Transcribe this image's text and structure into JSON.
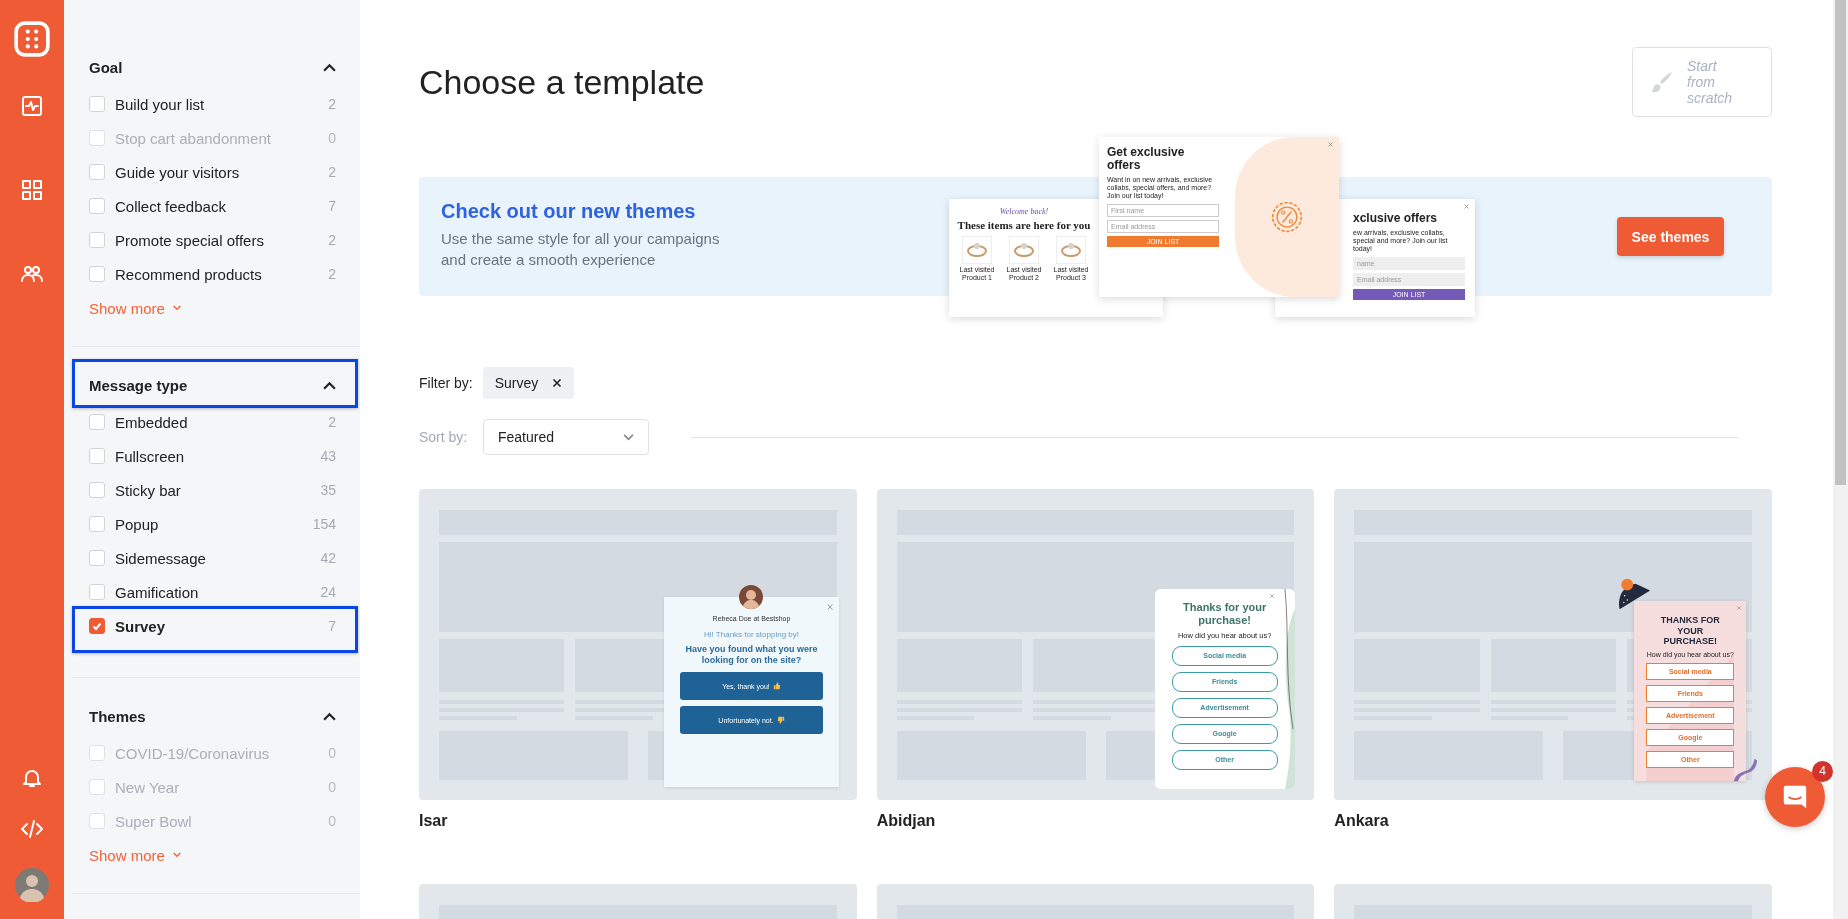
{
  "filters": [
    {
      "title": "Goal",
      "expanded": true,
      "highlighted": false,
      "show_more": "Show more",
      "items": [
        {
          "label": "Build your list",
          "count": "2",
          "checked": false,
          "disabled": false,
          "highlighted": false
        },
        {
          "label": "Stop cart abandonment",
          "count": "0",
          "checked": false,
          "disabled": true,
          "highlighted": false
        },
        {
          "label": "Guide your visitors",
          "count": "2",
          "checked": false,
          "disabled": false,
          "highlighted": false
        },
        {
          "label": "Collect feedback",
          "count": "7",
          "checked": false,
          "disabled": false,
          "highlighted": false
        },
        {
          "label": "Promote special offers",
          "count": "2",
          "checked": false,
          "disabled": false,
          "highlighted": false
        },
        {
          "label": "Recommend products",
          "count": "2",
          "checked": false,
          "disabled": false,
          "highlighted": false
        }
      ]
    },
    {
      "title": "Message type",
      "expanded": true,
      "highlighted": true,
      "items": [
        {
          "label": "Embedded",
          "count": "2",
          "checked": false,
          "disabled": false,
          "highlighted": false
        },
        {
          "label": "Fullscreen",
          "count": "43",
          "checked": false,
          "disabled": false,
          "highlighted": false
        },
        {
          "label": "Sticky bar",
          "count": "35",
          "checked": false,
          "disabled": false,
          "highlighted": false
        },
        {
          "label": "Popup",
          "count": "154",
          "checked": false,
          "disabled": false,
          "highlighted": false
        },
        {
          "label": "Sidemessage",
          "count": "42",
          "checked": false,
          "disabled": false,
          "highlighted": false
        },
        {
          "label": "Gamification",
          "count": "24",
          "checked": false,
          "disabled": false,
          "highlighted": false
        },
        {
          "label": "Survey",
          "count": "7",
          "checked": true,
          "disabled": false,
          "highlighted": true
        }
      ]
    },
    {
      "title": "Themes",
      "expanded": true,
      "highlighted": false,
      "show_more": "Show more",
      "items": [
        {
          "label": "COVID-19/Coronavirus",
          "count": "0",
          "checked": false,
          "disabled": true,
          "highlighted": false
        },
        {
          "label": "New Year",
          "count": "0",
          "checked": false,
          "disabled": true,
          "highlighted": false
        },
        {
          "label": "Super Bowl",
          "count": "0",
          "checked": false,
          "disabled": true,
          "highlighted": false
        }
      ]
    }
  ],
  "page": {
    "title": "Choose a template",
    "start_button": "Start from scratch"
  },
  "banner": {
    "title": "Check out our new themes",
    "text": "Use the same style for all your campaigns and create a smooth experience",
    "button": "See themes",
    "mockups": [
      {
        "kind": "products",
        "subtitle": "Welcome back!",
        "title": "These items are here for you",
        "products": [
          "Last visited Product 1",
          "Last visited Product 2",
          "Last visited Product 3"
        ]
      },
      {
        "kind": "signup",
        "title": "Get exclusive offers",
        "text": "Want in on new arrivals, exclusive collabs, special offers, and more? Join our list today!",
        "fields": [
          "First name",
          "Email address"
        ],
        "button": "JOIN LIST"
      },
      {
        "kind": "signup_cut",
        "title": "xclusive offers",
        "text": "ew arrivals, exclusive collabs, special and more? Join our list today!",
        "fields": [
          "name",
          "Email address"
        ],
        "button": "JOIN LIST"
      }
    ]
  },
  "filter_by": {
    "label": "Filter by:",
    "chips": [
      {
        "label": "Survey"
      }
    ]
  },
  "sort_by": {
    "label": "Sort by:",
    "value": "Featured"
  },
  "templates": [
    {
      "kind": "template",
      "name": "Isar",
      "preview": {
        "kind": "chat",
        "sender": "Rebeca Doe at Bestshop",
        "greeting": "Hi! Thanks for stopping by!",
        "question": "Have you found what you were looking for on the site?",
        "answers": [
          {
            "label": "Yes, thank you!",
            "kind": "up"
          },
          {
            "label": "Unfortunately not.",
            "kind": "down"
          }
        ]
      }
    },
    {
      "kind": "template",
      "name": "Abidjan",
      "preview": {
        "kind": "choices",
        "title": "Thanks for your purchase!",
        "question": "How did you hear about us?",
        "options": [
          "Social media",
          "Friends",
          "Advertisement",
          "Google",
          "Other"
        ]
      }
    },
    {
      "kind": "template",
      "name": "Ankara",
      "preview": {
        "kind": "choices_boxed",
        "title": "THANKS FOR YOUR PURCHASE!",
        "question": "How did you hear about us?",
        "options": [
          "Social media",
          "Friends",
          "Advertisement",
          "Google",
          "Other"
        ]
      }
    },
    {
      "kind": "blank"
    },
    {
      "kind": "blank"
    },
    {
      "kind": "blank"
    }
  ],
  "chat": {
    "badge": "4"
  }
}
